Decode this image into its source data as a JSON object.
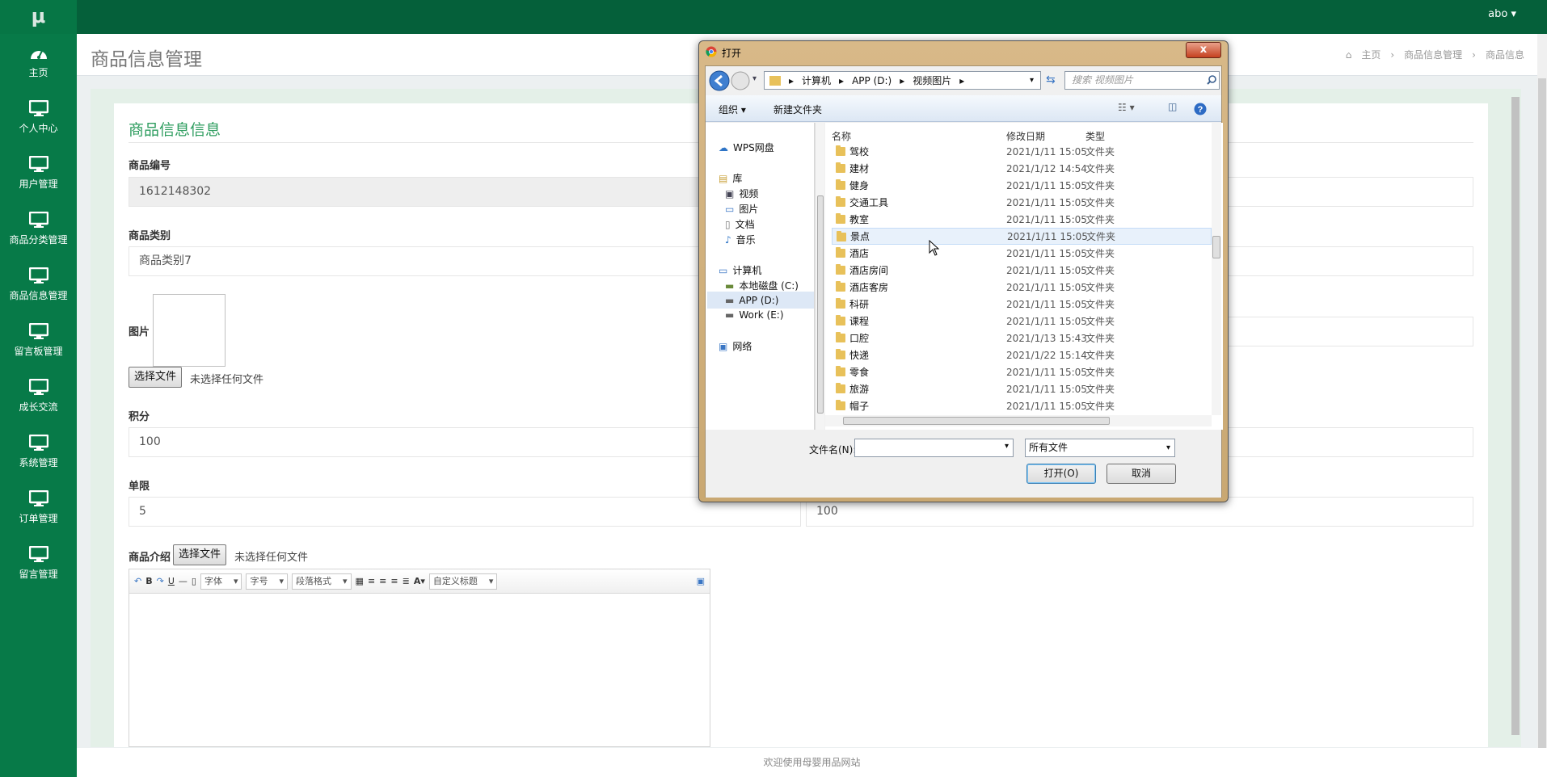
{
  "app": {
    "logo": "μ",
    "user": "abo ▾"
  },
  "sidebar": {
    "items": [
      {
        "label": "主页"
      },
      {
        "label": "个人中心"
      },
      {
        "label": "用户管理"
      },
      {
        "label": "商品分类管理"
      },
      {
        "label": "商品信息管理"
      },
      {
        "label": "留言板管理"
      },
      {
        "label": "成长交流"
      },
      {
        "label": "系统管理"
      },
      {
        "label": "订单管理"
      },
      {
        "label": "留言管理"
      }
    ]
  },
  "header": {
    "title": "商品信息管理",
    "breadcrumb": [
      "主页",
      "商品信息管理",
      "商品信息"
    ]
  },
  "form": {
    "card_title": "商品信息信息",
    "product_no_label": "商品编号",
    "product_no_value": "1612148302",
    "category_label": "商品类别",
    "category_value": "商品类别7",
    "image_label": "图片",
    "choose_file": "选择文件",
    "no_file": "未选择任何文件",
    "points_label": "积分",
    "points_value": "100",
    "limit_label": "单限",
    "limit_value": "5",
    "right_field_value": "100",
    "intro_label": "商品介绍",
    "editor": {
      "font": "字体",
      "size": "字号",
      "paragraph": "段落格式",
      "custom_title": "自定义标题"
    }
  },
  "footer": "欢迎使用母婴用品网站",
  "dialog": {
    "title": "打开",
    "close": "x",
    "address": [
      "计算机",
      "APP (D:)",
      "视频图片"
    ],
    "search_placeholder": "搜索 视频图片",
    "organize": "组织 ▾",
    "new_folder": "新建文件夹",
    "nav": [
      {
        "label": "WPS网盘"
      },
      {
        "label": "库"
      },
      {
        "label": "视频"
      },
      {
        "label": "图片"
      },
      {
        "label": "文档"
      },
      {
        "label": "音乐"
      },
      {
        "label": "计算机"
      },
      {
        "label": "本地磁盘 (C:)"
      },
      {
        "label": "APP (D:)"
      },
      {
        "label": "Work (E:)"
      },
      {
        "label": "网络"
      }
    ],
    "columns": {
      "name": "名称",
      "date": "修改日期",
      "type": "类型"
    },
    "files": [
      {
        "name": "驾校",
        "date": "2021/1/11 15:05",
        "type": "文件夹"
      },
      {
        "name": "建材",
        "date": "2021/1/12 14:54",
        "type": "文件夹"
      },
      {
        "name": "健身",
        "date": "2021/1/11 15:05",
        "type": "文件夹"
      },
      {
        "name": "交通工具",
        "date": "2021/1/11 15:05",
        "type": "文件夹"
      },
      {
        "name": "教室",
        "date": "2021/1/11 15:05",
        "type": "文件夹"
      },
      {
        "name": "景点",
        "date": "2021/1/11 15:05",
        "type": "文件夹"
      },
      {
        "name": "酒店",
        "date": "2021/1/11 15:05",
        "type": "文件夹"
      },
      {
        "name": "酒店房间",
        "date": "2021/1/11 15:05",
        "type": "文件夹"
      },
      {
        "name": "酒店客房",
        "date": "2021/1/11 15:05",
        "type": "文件夹"
      },
      {
        "name": "科研",
        "date": "2021/1/11 15:05",
        "type": "文件夹"
      },
      {
        "name": "课程",
        "date": "2021/1/11 15:05",
        "type": "文件夹"
      },
      {
        "name": "口腔",
        "date": "2021/1/13 15:43",
        "type": "文件夹"
      },
      {
        "name": "快递",
        "date": "2021/1/22 15:14",
        "type": "文件夹"
      },
      {
        "name": "零食",
        "date": "2021/1/11 15:05",
        "type": "文件夹"
      },
      {
        "name": "旅游",
        "date": "2021/1/11 15:05",
        "type": "文件夹"
      },
      {
        "name": "帽子",
        "date": "2021/1/11 15:05",
        "type": "文件夹"
      }
    ],
    "filename_label": "文件名(N):",
    "filename_value": "",
    "filter": "所有文件",
    "open": "打开(O)",
    "cancel": "取消"
  },
  "colors": {
    "brand": "#077a48",
    "topbar": "#05603a",
    "accent_text": "#2e9d5f"
  }
}
